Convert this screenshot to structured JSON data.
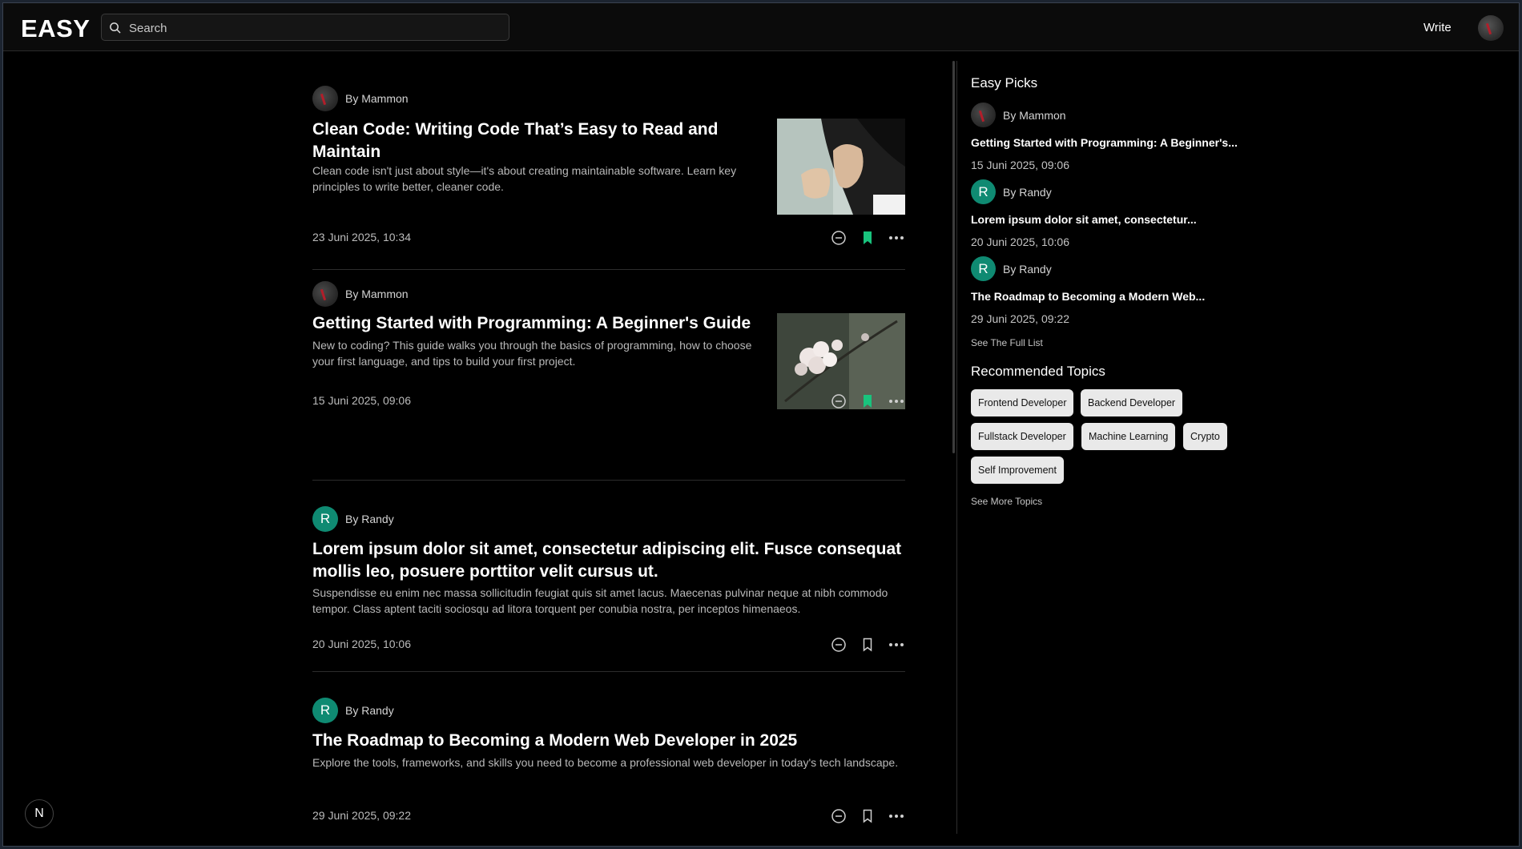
{
  "header": {
    "logo": "EASY",
    "search_placeholder": "Search",
    "write_label": "Write"
  },
  "feed": [
    {
      "author": "By Mammon",
      "avatar": "mammon-avatar",
      "title": "Clean Code: Writing Code That’s Easy to Read and Maintain",
      "description": "Clean code isn't just about style—it's about creating maintainable software. Learn key principles to write better, cleaner code.",
      "date": "23 Juni 2025, 10:34",
      "bookmarked": true,
      "thumbnail": "praying-man-illustration"
    },
    {
      "author": "By Mammon",
      "avatar": "mammon-avatar",
      "title": "Getting Started with Programming: A Beginner's Guide",
      "description": "New to coding? This guide walks you through the basics of programming, how to choose your first language, and tips to build your first project.",
      "date": "15 Juni 2025, 09:06",
      "bookmarked": true,
      "thumbnail": "cherry-blossom-photo"
    },
    {
      "author": "By Randy",
      "avatar_letter": "R",
      "title": "Lorem ipsum dolor sit amet, consectetur adipiscing elit. Fusce consequat mollis leo, posuere porttitor velit cursus ut.",
      "description": "Suspendisse eu enim nec massa sollicitudin feugiat quis sit amet lacus. Maecenas pulvinar neque at nibh commodo tempor. Class aptent taciti sociosqu ad litora torquent per conubia nostra, per inceptos himenaeos.",
      "date": "20 Juni 2025, 10:06",
      "bookmarked": false
    },
    {
      "author": "By Randy",
      "avatar_letter": "R",
      "title": "The Roadmap to Becoming a Modern Web Developer in 2025",
      "description": "Explore the tools, frameworks, and skills you need to become a professional web developer in today's tech landscape.",
      "date": "29 Juni 2025, 09:22",
      "bookmarked": false
    }
  ],
  "sidebar": {
    "picks_heading": "Easy Picks",
    "picks": [
      {
        "author": "By Mammon",
        "title": "Getting Started with Programming: A Beginner's...",
        "date": "15 Juni 2025, 09:06"
      },
      {
        "author": "By Randy",
        "avatar_letter": "R",
        "title": "Lorem ipsum dolor sit amet, consectetur...",
        "date": "20 Juni 2025, 10:06"
      },
      {
        "author": "By Randy",
        "avatar_letter": "R",
        "title": "The Roadmap to Becoming a Modern Web...",
        "date": "29 Juni 2025, 09:22"
      }
    ],
    "see_full_list": "See The Full List",
    "topics_heading": "Recommended Topics",
    "topics": [
      "Frontend Developer",
      "Backend Developer",
      "Fullstack Developer",
      "Machine Learning",
      "Crypto",
      "Self Improvement"
    ],
    "see_more_topics": "See More Topics"
  },
  "fab_letter": "N",
  "colors": {
    "background": "#000000",
    "accent_bookmark": "#19c37d",
    "avatar_randy": "#0f8a72",
    "chip_bg": "#e9e9e9"
  }
}
